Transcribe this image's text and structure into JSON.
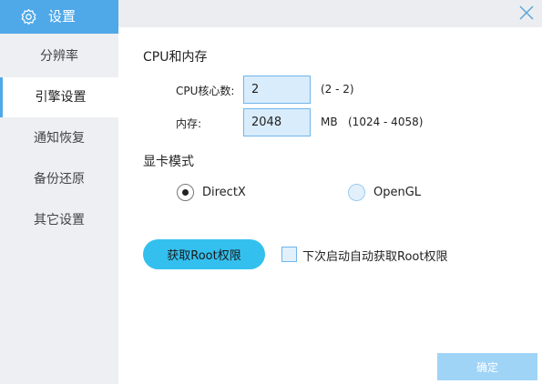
{
  "sidebar": {
    "title": "设置",
    "items": [
      {
        "label": "分辨率"
      },
      {
        "label": "引擎设置"
      },
      {
        "label": "通知恢复"
      },
      {
        "label": "备份还原"
      },
      {
        "label": "其它设置"
      }
    ],
    "active_index": 1
  },
  "cpu_memory": {
    "title": "CPU和内存",
    "cpu_label": "CPU核心数:",
    "cpu_value": "2",
    "cpu_range": "(2 - 2)",
    "mem_label": "内存:",
    "mem_value": "2048",
    "mem_unit": "MB",
    "mem_range": "(1024 - 4058)"
  },
  "display_mode": {
    "title": "显卡模式",
    "options": [
      {
        "label": "DirectX",
        "checked": true
      },
      {
        "label": "OpenGL",
        "checked": false
      }
    ]
  },
  "root": {
    "button_label": "获取Root权限",
    "auto_label": "下次启动自动获取Root权限",
    "auto_checked": false
  },
  "footer": {
    "confirm_label": "确定"
  },
  "colors": {
    "accent": "#4fa8e8",
    "button": "#33c0ef",
    "input_bg": "#d9ecfb"
  }
}
